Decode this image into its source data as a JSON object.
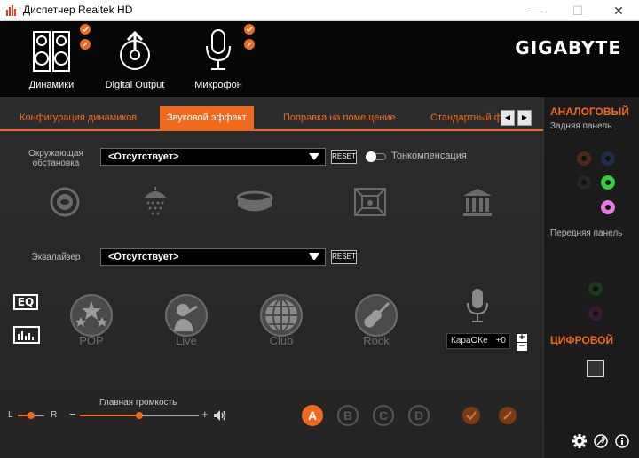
{
  "window": {
    "title": "Диспетчер Realtek HD",
    "minimize": "—",
    "maximize": "☐",
    "close": "✕"
  },
  "brand": {
    "logo": "GIGABYTE"
  },
  "devices": [
    {
      "label": "Динамики",
      "icon": "speaker-icon",
      "active": true
    },
    {
      "label": "Digital Output",
      "icon": "digital-output-icon",
      "active": false
    },
    {
      "label": "Микрофон",
      "icon": "microphone-icon",
      "active": false
    }
  ],
  "tabs": [
    {
      "label": "Конфигурация динамиков",
      "active": false
    },
    {
      "label": "Звуковой эффект",
      "active": true
    },
    {
      "label": "Поправка на помещение",
      "active": false
    },
    {
      "label": "Стандартный ф",
      "active": false
    }
  ],
  "tab_nav": {
    "prev": "◀",
    "next": "▶"
  },
  "environment": {
    "label_line1": "Окружающая",
    "label_line2": "обстановка",
    "selected": "<Отсутствует>",
    "reset": "RESET",
    "loudness_label": "Тонкомпенсация",
    "loudness_on": false,
    "icons": [
      "sewer-pipe-icon",
      "shower-icon",
      "stadium-icon",
      "room-icon",
      "concert-hall-icon"
    ]
  },
  "equalizer": {
    "label": "Эквалайзер",
    "selected": "<Отсутствует>",
    "reset": "RESET",
    "eq_button": "EQ",
    "presets": [
      "POP",
      "Live",
      "Club",
      "Rock"
    ],
    "karaoke_label": "КараОКе",
    "karaoke_value": "+0",
    "plus": "+",
    "minus": "−"
  },
  "volume": {
    "balance_left": "L",
    "balance_right": "R",
    "balance_level": 0.5,
    "main_label": "Главная громкость",
    "minus": "−",
    "plus": "+",
    "main_level": 0.5
  },
  "profiles": [
    "A",
    "B",
    "C",
    "D"
  ],
  "side": {
    "analog_title": "АНАЛОГОВЫЙ",
    "rear_panel": "Задняя панель",
    "front_panel": "Передняя панель",
    "digital_title": "ЦИФРОВОЙ"
  },
  "colors": {
    "accent": "#f06a1e",
    "background": "#1a1a1a"
  }
}
